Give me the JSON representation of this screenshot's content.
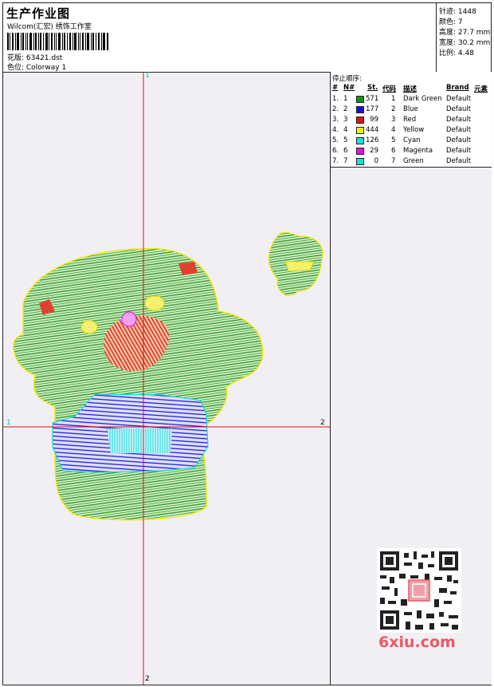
{
  "header": {
    "title": "生产作业图",
    "company": "Wilcom(汇宏) 绣饰工作室",
    "design_label": "花版: 63421.dst",
    "colorway_label": "色位: Colorway 1"
  },
  "stats": {
    "stitches": "针迹: 1448",
    "colors": "颜色: 7",
    "height": "高度: 27.7 mm",
    "width": "宽度: 30.2 mm",
    "scale": "比例: 4.48"
  },
  "stop_sequence": {
    "caption": "停止顺序:",
    "headers": {
      "num": "#",
      "n": "N#",
      "st": "St.",
      "code": "代码",
      "desc": "描述",
      "brand": "Brand",
      "element": "元素"
    },
    "rows": [
      {
        "num": "1.",
        "n": "1",
        "st": "571",
        "code": "1",
        "desc": "Dark Green",
        "brand": "Default",
        "color": "#1a8c1a"
      },
      {
        "num": "2.",
        "n": "2",
        "st": "177",
        "code": "2",
        "desc": "Blue",
        "brand": "Default",
        "color": "#1414e0"
      },
      {
        "num": "3.",
        "n": "3",
        "st": "99",
        "code": "3",
        "desc": "Red",
        "brand": "Default",
        "color": "#e01414"
      },
      {
        "num": "4.",
        "n": "4",
        "st": "444",
        "code": "4",
        "desc": "Yellow",
        "brand": "Default",
        "color": "#f2f200"
      },
      {
        "num": "5.",
        "n": "5",
        "st": "126",
        "code": "5",
        "desc": "Cyan",
        "brand": "Default",
        "color": "#14e0e0"
      },
      {
        "num": "6.",
        "n": "6",
        "st": "29",
        "code": "6",
        "desc": "Magenta",
        "brand": "Default",
        "color": "#e014e0"
      },
      {
        "num": "7.",
        "n": "7",
        "st": "0",
        "code": "7",
        "desc": "Green",
        "brand": "Default",
        "color": "#14e0d0"
      }
    ]
  },
  "axes": {
    "top": "1",
    "bottom": "2",
    "left": "1",
    "right": "2"
  },
  "watermark": "6xiu.com"
}
